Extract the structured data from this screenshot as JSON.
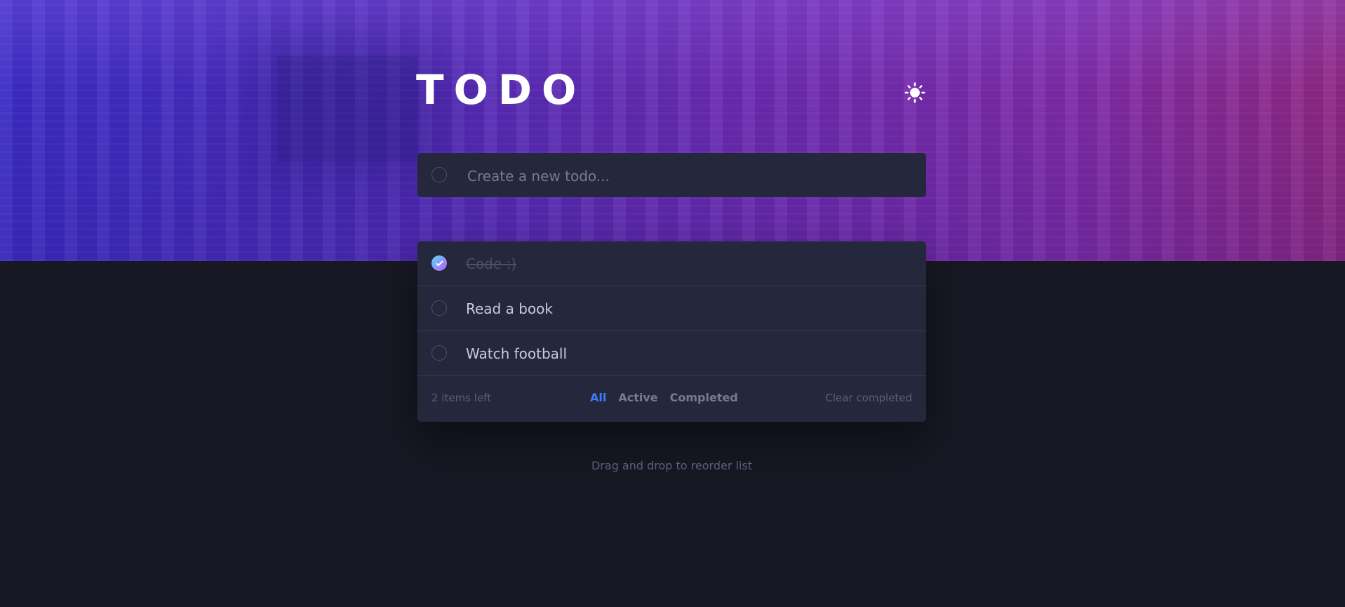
{
  "header": {
    "title": "TODO",
    "theme_icon": "sun-icon"
  },
  "new_todo": {
    "placeholder": "Create a new todo..."
  },
  "todos": [
    {
      "text": "Code :)",
      "completed": true
    },
    {
      "text": "Read a book",
      "completed": false
    },
    {
      "text": "Watch football",
      "completed": false
    }
  ],
  "footer": {
    "items_left": "2 items left",
    "filters": [
      "All",
      "Active",
      "Completed"
    ],
    "active_filter": "All",
    "clear_label": "Clear completed"
  },
  "hint": "Drag and drop to reorder list",
  "colors": {
    "accent": "#3a7cfd",
    "check_gradient_start": "#57ddff",
    "check_gradient_end": "#c058f3",
    "card_bg": "#25273c",
    "page_bg": "#181824"
  }
}
